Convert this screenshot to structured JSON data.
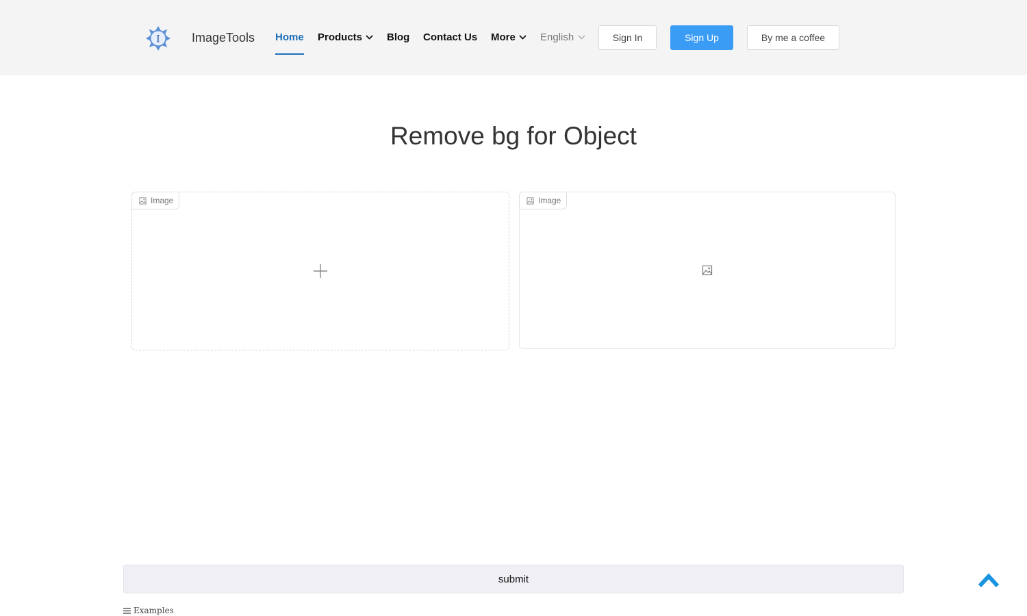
{
  "brand": {
    "name": "ImageTools",
    "logo_icon": "snowflake-logo-icon",
    "logo_letter": "I"
  },
  "nav": {
    "home": "Home",
    "products": "Products",
    "blog": "Blog",
    "contact": "Contact Us",
    "more": "More",
    "language": "English"
  },
  "auth": {
    "sign_in": "Sign In",
    "sign_up": "Sign Up",
    "coffee": "By me a coffee"
  },
  "page": {
    "title": "Remove bg for Object"
  },
  "input_panel": {
    "label": "Image",
    "icon": "plus-icon"
  },
  "output_panel": {
    "label": "Image",
    "icon": "image-icon"
  },
  "submit": {
    "label": "submit"
  },
  "examples": {
    "label": "Examples"
  },
  "colors": {
    "accent": "#1e6fb8",
    "primary_button": "#3b9cf5",
    "header_bg": "#f4f4f4",
    "scroll_top": "#1a94e0"
  }
}
